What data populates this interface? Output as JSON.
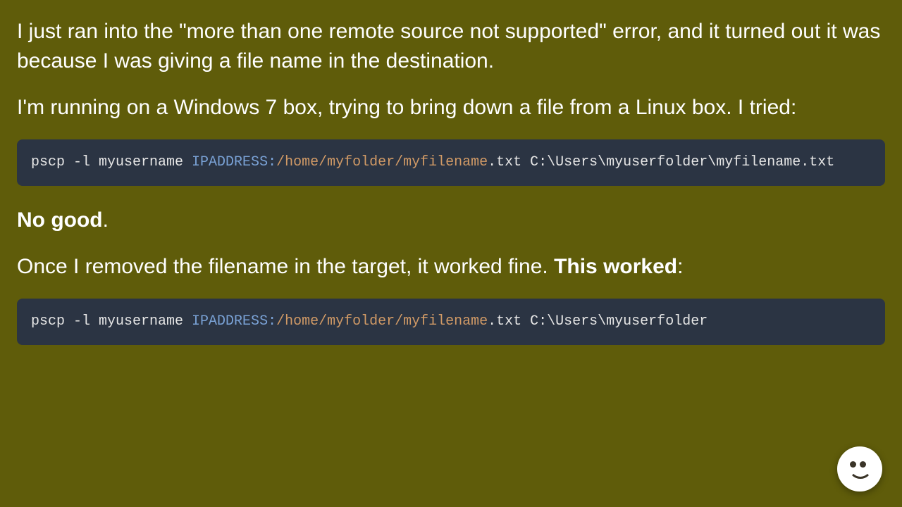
{
  "paragraphs": {
    "p1": "I just ran into the \"more than one remote source not supported\" error, and it turned out it was because I was giving a file name in the destination.",
    "p2": "I'm running on a Windows 7 box, trying to bring down a file from a Linux box. I tried:",
    "p3_strong": "No good",
    "p3_after": ".",
    "p4_before": "Once I removed the filename in the target, it worked fine. ",
    "p4_strong": "This worked",
    "p4_after": ":"
  },
  "code1": {
    "prefix": "pscp -l myusername ",
    "ip": "IPADDRESS:",
    "remote_path": "/home/myfolder/myfilename",
    "ext": ".txt ",
    "win_path": "C:\\Users\\myuserfolder\\myfilename.txt"
  },
  "code2": {
    "prefix": "pscp -l myusername ",
    "ip": "IPADDRESS:",
    "remote_path": "/home/myfolder/myfilename",
    "ext": ".txt ",
    "win_path": "C:\\Users\\myuserfolder"
  }
}
